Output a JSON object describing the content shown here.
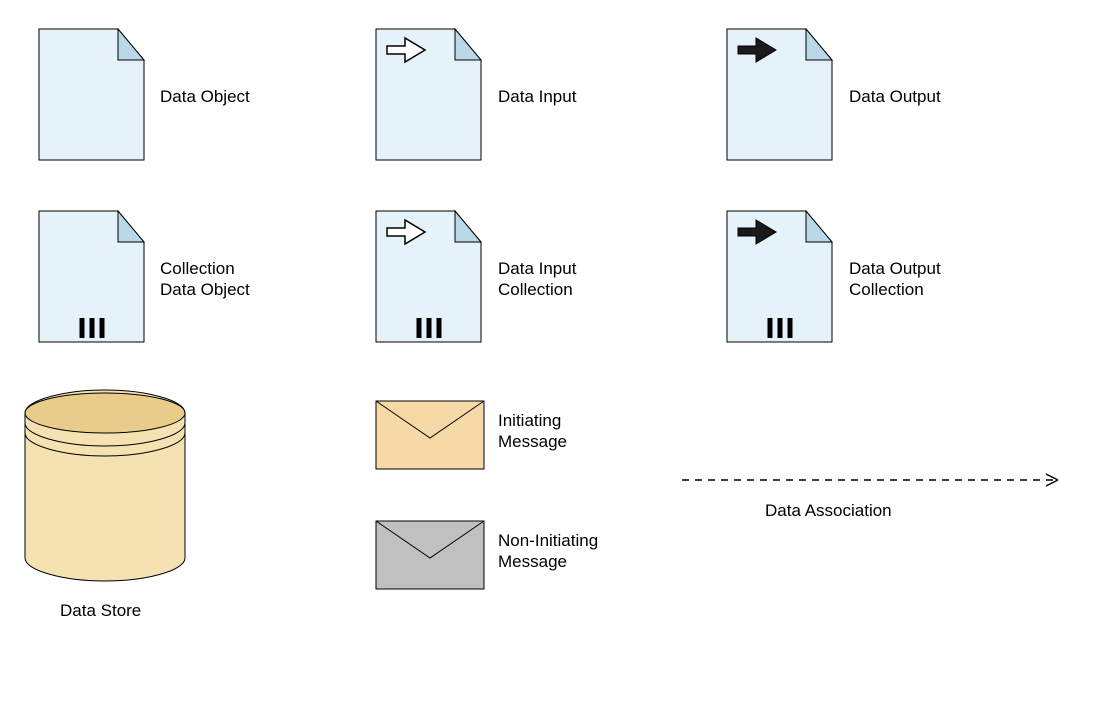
{
  "labels": {
    "dataObject": "Data Object",
    "dataInput": "Data Input",
    "dataOutput": "Data Output",
    "collectionDataObject_line1": "Collection",
    "collectionDataObject_line2": "Data Object",
    "dataInputCollection_line1": "Data Input",
    "dataInputCollection_line2": "Collection",
    "dataOutputCollection_line1": "Data Output",
    "dataOutputCollection_line2": "Collection",
    "dataStore": "Data Store",
    "initiatingMessage_line1": "Initiating",
    "initiatingMessage_line2": "Message",
    "nonInitiatingMessage_line1": "Non-Initiating",
    "nonInitiatingMessage_line2": "Message",
    "dataAssociation": "Data Association"
  },
  "colors": {
    "docFill": "#E6F2FA",
    "docFold": "#B9D9E8",
    "stroke": "#000000",
    "envelopeInit": "#F7D9A8",
    "envelopeNonInit": "#C0C0C0",
    "datastoreLight": "#F5E2B3",
    "datastoreDark": "#E8CC8A"
  }
}
